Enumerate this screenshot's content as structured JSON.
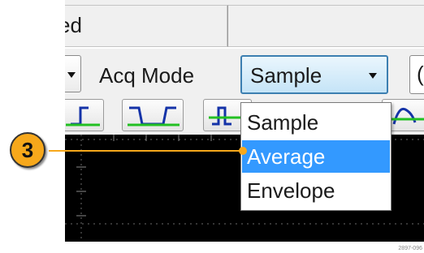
{
  "status_bar": {
    "cell1_text": "ed"
  },
  "toolbar": {
    "acq_mode_label": "Acq Mode",
    "acq_mode_value": "Sample",
    "right_cut_text": "("
  },
  "dropdown": {
    "options": [
      "Sample",
      "Average",
      "Envelope"
    ],
    "selected": "Average"
  },
  "callout": {
    "number": "3",
    "color": "#f7a81b"
  },
  "figure_id": "2897-096",
  "colors": {
    "selection": "#3399ff",
    "waveform_icon_green": "#22c022",
    "scope_background": "#000000",
    "select_border": "#3c7fb1"
  },
  "icons": [
    "rising-edge-icon",
    "pulse-width-icon",
    "runt-icon",
    "transition-icon"
  ]
}
